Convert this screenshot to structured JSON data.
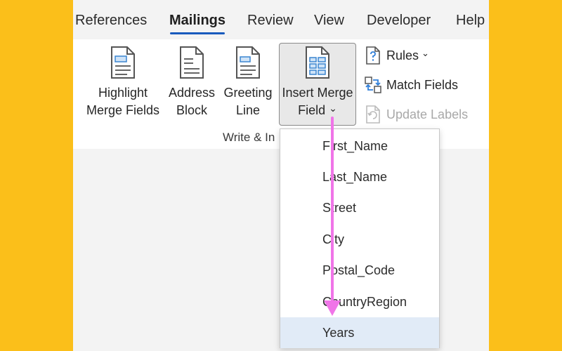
{
  "tabs": [
    {
      "label": "References"
    },
    {
      "label": "Mailings"
    },
    {
      "label": "Review"
    },
    {
      "label": "View"
    },
    {
      "label": "Developer"
    },
    {
      "label": "Help"
    }
  ],
  "active_tab": "Mailings",
  "ribbon": {
    "highlight": {
      "line1": "Highlight",
      "line2": "Merge Fields"
    },
    "address": {
      "line1": "Address",
      "line2": "Block"
    },
    "greeting": {
      "line1": "Greeting",
      "line2": "Line"
    },
    "insert_merge": {
      "line1": "Insert Merge",
      "line2": "Field",
      "chevron": "⌄"
    },
    "rules": {
      "label": "Rules",
      "chevron": "⌄"
    },
    "match_fields": {
      "label": "Match Fields"
    },
    "update_labels": {
      "label": "Update Labels"
    },
    "group_label": "Write & In"
  },
  "merge_fields": [
    "First_Name",
    "Last_Name",
    "Street",
    "City",
    "Postal_Code",
    "CountryRegion",
    "Years"
  ],
  "colors": {
    "background": "#fbbf1a",
    "accent": "#185abd",
    "arrow": "#f075e8",
    "highlight_row": "#e1ebf7"
  },
  "icons": {
    "document": "document-icon",
    "rules": "rules-question-icon",
    "match_fields": "match-fields-icon",
    "update_labels": "update-labels-icon"
  }
}
